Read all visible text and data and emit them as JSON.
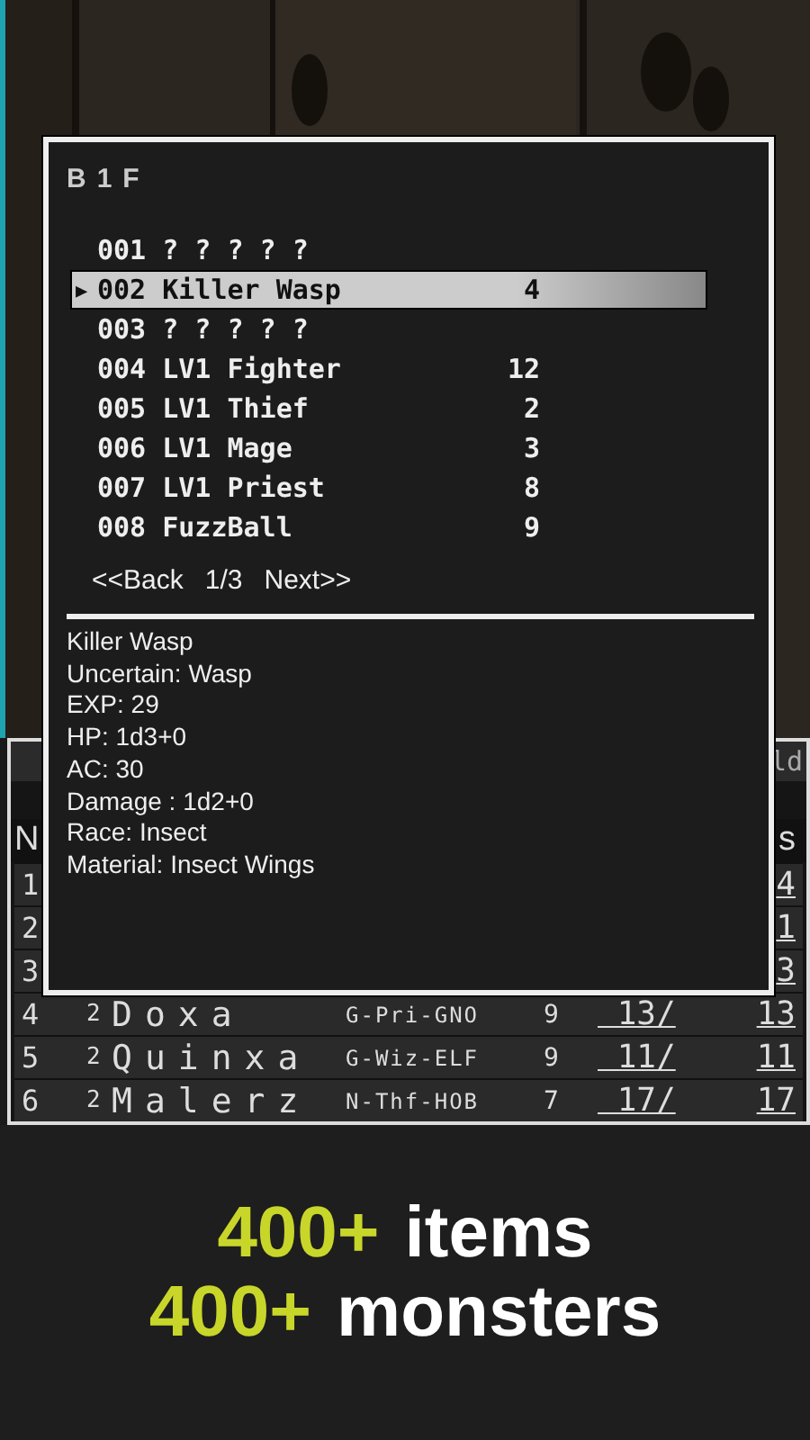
{
  "party_bar": {
    "text": "ld"
  },
  "party_table": {
    "header": {
      "column_1": "N",
      "column_2": "s"
    },
    "rows": [
      {
        "no": "1",
        "hp_tail": "4"
      },
      {
        "no": "2",
        "hp_tail": "1"
      },
      {
        "no": "3",
        "hp_tail": "3"
      },
      {
        "no": "4",
        "level": "2",
        "name": "Doxa",
        "class": "G-Pri-GNO",
        "ac": "9",
        "hp": "13/",
        "max_hp": "13"
      },
      {
        "no": "5",
        "level": "2",
        "name": "Quinxa",
        "class": "G-Wiz-ELF",
        "ac": "9",
        "hp": "11/",
        "max_hp": "11"
      },
      {
        "no": "6",
        "level": "2",
        "name": "Malerz",
        "class": "N-Thf-HOB",
        "ac": "7",
        "hp": "17/",
        "max_hp": "17"
      }
    ]
  },
  "dialog": {
    "title": "B1F",
    "entries": [
      {
        "number": "001",
        "name": "? ? ? ? ?",
        "selected": false
      },
      {
        "number": "002",
        "name": "Killer Wasp",
        "count": "4",
        "selected": true
      },
      {
        "number": "003",
        "name": "? ? ? ? ?",
        "selected": false
      },
      {
        "number": "004",
        "name": "LV1 Fighter",
        "count": "12",
        "selected": false
      },
      {
        "number": "005",
        "name": "LV1 Thief",
        "count": "2",
        "selected": false
      },
      {
        "number": "006",
        "name": "LV1 Mage",
        "count": "3",
        "selected": false
      },
      {
        "number": "007",
        "name": "LV1 Priest",
        "count": "8",
        "selected": false
      },
      {
        "number": "008",
        "name": "FuzzBall",
        "count": "9",
        "selected": false
      }
    ],
    "cursor": "▶",
    "pager": {
      "back": "<<Back",
      "page": "1/3",
      "next": "Next>>"
    },
    "details": [
      "Killer Wasp",
      "Uncertain: Wasp",
      "EXP: 29",
      "HP: 1d3+0",
      "AC: 30",
      "Damage : 1d2+0",
      "Race: Insect",
      "Material: Insect Wings"
    ]
  },
  "banner": [
    {
      "number": "400+",
      "word": "items"
    },
    {
      "number": "400+",
      "word": "monsters"
    }
  ]
}
